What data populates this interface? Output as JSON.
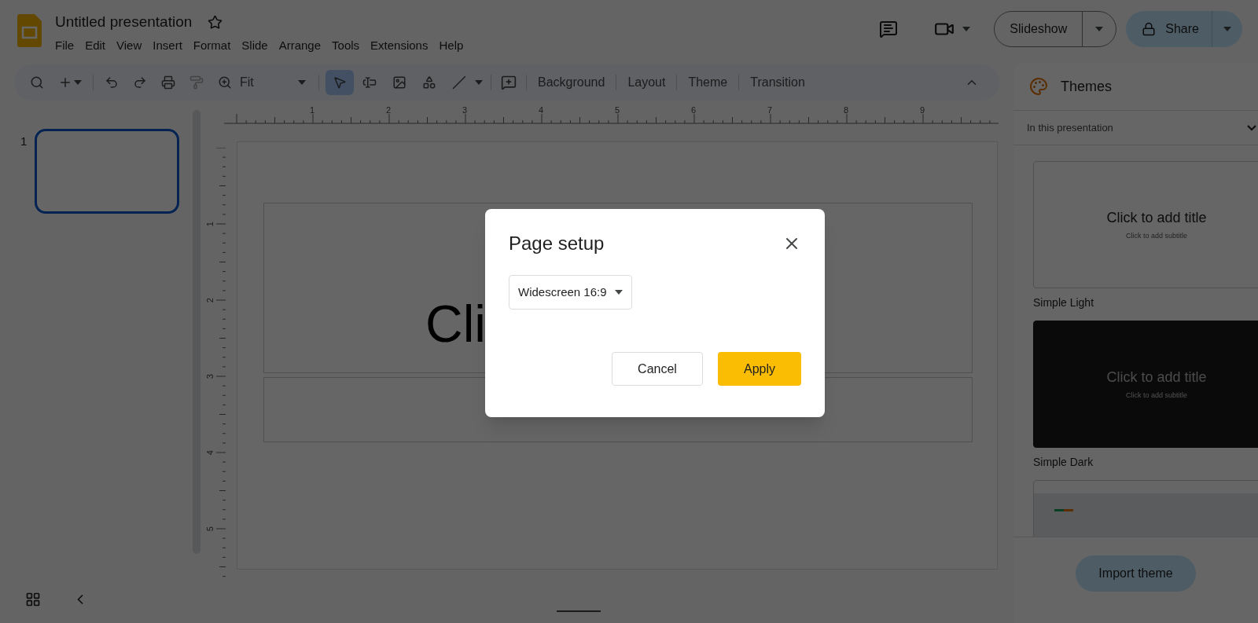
{
  "app": {
    "doc_title": "Untitled presentation",
    "menu": [
      "File",
      "Edit",
      "View",
      "Insert",
      "Format",
      "Slide",
      "Arrange",
      "Tools",
      "Extensions",
      "Help"
    ]
  },
  "header_buttons": {
    "slideshow": "Slideshow",
    "share": "Share"
  },
  "toolbar": {
    "zoom": "Fit",
    "tools": [
      {
        "kind": "select",
        "selected": true
      },
      {
        "kind": "textbox",
        "selected": false
      },
      {
        "kind": "image",
        "selected": false
      },
      {
        "kind": "shape",
        "selected": false
      },
      {
        "kind": "line",
        "selected": false
      }
    ],
    "text_buttons": [
      "Background",
      "Layout",
      "Theme",
      "Transition"
    ]
  },
  "ruler": {
    "h_labels": [
      "1",
      "2",
      "3",
      "4",
      "5",
      "6",
      "7",
      "8",
      "9"
    ],
    "v_labels": [
      "1",
      "2",
      "3",
      "4",
      "5"
    ]
  },
  "filmstrip": [
    {
      "number": "1",
      "selected": true
    }
  ],
  "slide": {
    "title_visible": "Cli"
  },
  "themes_panel": {
    "title": "Themes",
    "filter": "In this presentation",
    "themes": [
      {
        "kind": "light",
        "name": "Simple Light",
        "title": "Click to add title",
        "subtitle": "Click to add subtitle"
      },
      {
        "kind": "dark",
        "name": "Simple Dark",
        "title": "Click to add title",
        "subtitle": "Click to add subtitle"
      },
      {
        "kind": "accent"
      }
    ],
    "import_button": "Import theme"
  },
  "dialog": {
    "title": "Page setup",
    "size_select": "Widescreen 16:9",
    "buttons": [
      "Cancel",
      "Apply"
    ]
  }
}
